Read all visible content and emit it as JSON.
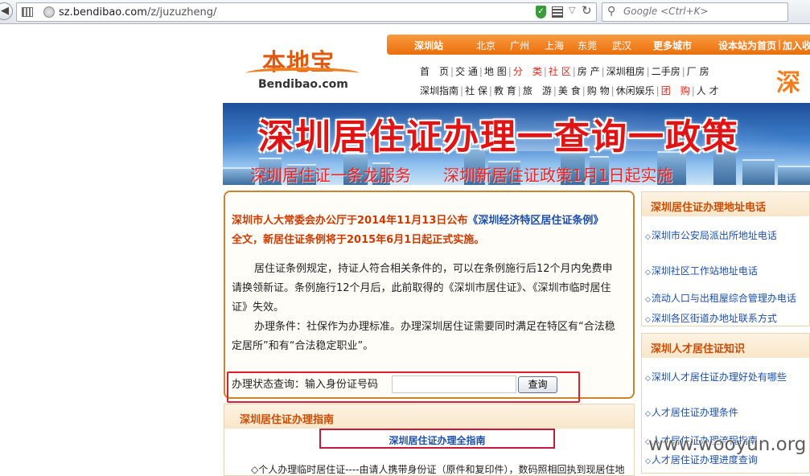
{
  "browser": {
    "url_host": "sz.bendibao.com",
    "url_path": "/z/juzuzheng/",
    "search_placeholder": "Google <Ctrl+K>"
  },
  "logo": {
    "cn": "本地宝",
    "en": "Bendibao.com"
  },
  "citybar": {
    "current": "深圳站",
    "cities": [
      "北京",
      "广州",
      "上海",
      "东莞",
      "武汉"
    ],
    "more": "更多城市",
    "homepage": "设本站为首页",
    "favorite": "加入收"
  },
  "nav": {
    "row1": [
      "首　页",
      "交 通",
      "地 图",
      "分　类",
      "社 区",
      "房 产",
      "深圳租房",
      "二手房",
      "厂 房"
    ],
    "row1_red": [
      3,
      4
    ],
    "row2": [
      "深圳指南",
      "社 保",
      "教 育",
      "旅　游",
      "美 食",
      "购 物",
      "休闲娱乐",
      "团　购",
      "人 才"
    ],
    "row2_red": [
      7
    ]
  },
  "side_brand": "深圳",
  "banner": {
    "title": "深圳居住证办理一查询一政策",
    "marquee": "深圳居住证一条龙服务　　深圳新居住证政策1月1日起实施"
  },
  "main": {
    "lead_prefix": "深圳市人大常委会办公厅于2014年11月13日公布",
    "lead_link": "《深圳经济特区居住证条例》",
    "lead_suffix": "全文，新居住证条例将于2015年6月1日起正式实施。",
    "para1": "居住证条例规定，持证人符合相关条件的，可以在条例施行后12个月内免费申请换领新证。条例施行12个月后，此前取得的《深圳市居住证》、《深圳市临时居住证》失效。",
    "para2": "办理条件：社保作为办理标准。办理深圳居住证需要同时满足在特区有“合法稳定居所”和有“合法稳定职业”。",
    "query_label": "办理状态查询：输入身份证号码",
    "query_button": "查询",
    "id_value": ""
  },
  "guide": {
    "title": "深圳居住证办理指南",
    "link": "深圳居住证办理全指南",
    "item": "◇个人办理临时居住证----由请人携带身份证（原件和复印件），数码照相回执到现居住地"
  },
  "sidebar": {
    "section1": {
      "title": "深圳居住证办理地址电话",
      "links": [
        "深圳市公安局派出所地址电话",
        "深圳社区工作站地址电话",
        "流动人口与出租屋综合管理办电话",
        "深圳各区街道办地址联系方式"
      ]
    },
    "section2": {
      "title": "深圳人才居住证知识",
      "links": [
        "深圳人才居住证办理好处有哪些",
        "人才居住证办理条件",
        "人才居住证办理流程指南",
        "人才居住证办理进度查询"
      ]
    }
  },
  "watermark": "www.wooyun.org",
  "colors": {
    "orange": "#ea6f0c",
    "highlight_red": "#e41d2b",
    "link_blue": "#1b4fae"
  }
}
